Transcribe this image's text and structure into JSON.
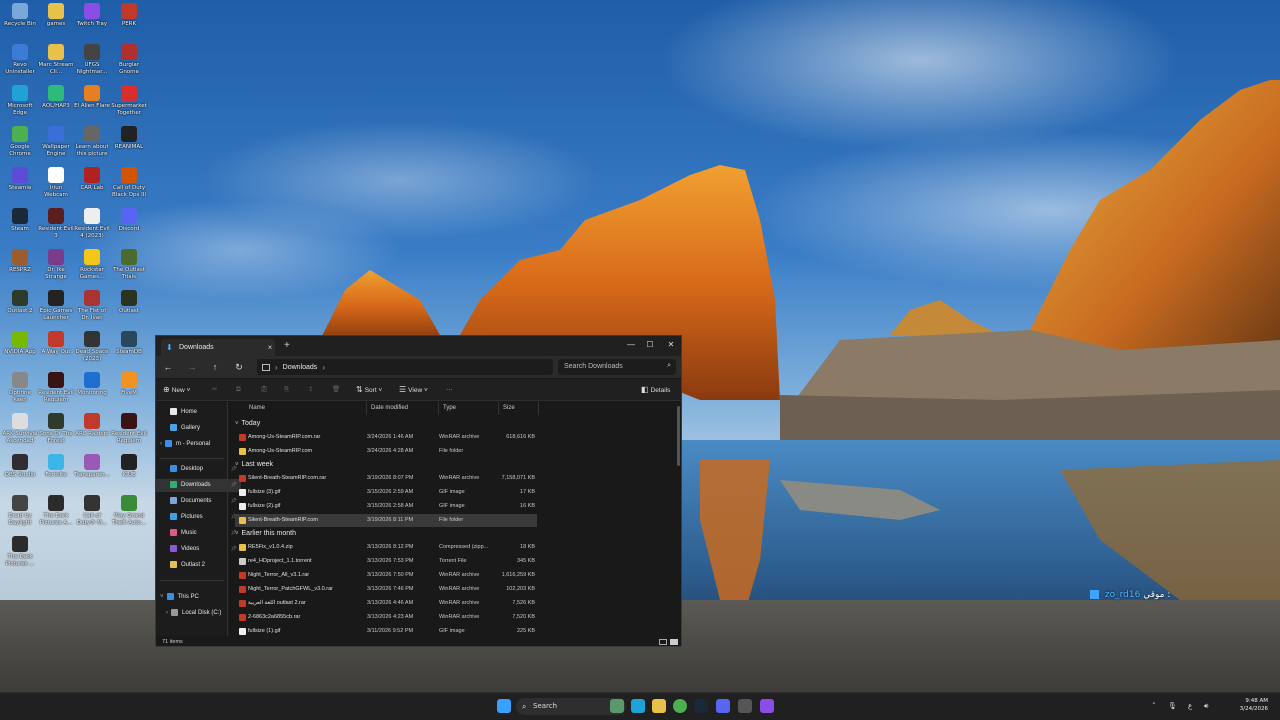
{
  "desktop": {
    "icons": [
      {
        "label": "Recycle Bin",
        "color": "#7aa7d9"
      },
      {
        "label": "games",
        "color": "#e8c14a"
      },
      {
        "label": "Twitch Tray",
        "color": "#8a4de6"
      },
      {
        "label": "PERK",
        "color": "#c0392b"
      },
      {
        "label": "Revo Uninstaller",
        "color": "#3d7bd6"
      },
      {
        "label": "Marc Stream Cli...",
        "color": "#e8c14a"
      },
      {
        "label": "UFGS Nightmar...",
        "color": "#444444"
      },
      {
        "label": "Burglar Gnome",
        "color": "#b03030"
      },
      {
        "label": "Microsoft Edge",
        "color": "#1fa3d6"
      },
      {
        "label": "AOL/HAP3",
        "color": "#2dba7a"
      },
      {
        "label": "El Alien Flare",
        "color": "#e67e22"
      },
      {
        "label": "Supermarket Together",
        "color": "#d92e2e"
      },
      {
        "label": "Google Chrome",
        "color": "#4caf50"
      },
      {
        "label": "Wallpaper Engine",
        "color": "#3a6fd9"
      },
      {
        "label": "Learn about this picture",
        "color": "#666666"
      },
      {
        "label": "REANIMAL",
        "color": "#222222"
      },
      {
        "label": "Steamie",
        "color": "#5b4bd6"
      },
      {
        "label": "Iriun Webcam",
        "color": "#ffffff"
      },
      {
        "label": "CAR Lab",
        "color": "#b02222"
      },
      {
        "label": "Call of Duty Black Ops III",
        "color": "#d35400"
      },
      {
        "label": "Steam",
        "color": "#1b2838"
      },
      {
        "label": "Resident Evil 3",
        "color": "#5a1e1e"
      },
      {
        "label": "Resident Evil 4 (2023)",
        "color": "#eeeeee"
      },
      {
        "label": "Discord",
        "color": "#5865f2"
      },
      {
        "label": "RESPRZ",
        "color": "#9b5d2e"
      },
      {
        "label": "Dr. Ike Strange",
        "color": "#7a3b8a"
      },
      {
        "label": "Rockstar Games...",
        "color": "#f5c518"
      },
      {
        "label": "The Outlast Trials",
        "color": "#4a6a2e"
      },
      {
        "label": "Outlast 2",
        "color": "#2f3b2a"
      },
      {
        "label": "Epic Games Launcher",
        "color": "#222222"
      },
      {
        "label": "The Fist of Dr. Ivan",
        "color": "#a33"
      },
      {
        "label": "Outlast",
        "color": "#2a3320"
      },
      {
        "label": "NVIDIA App",
        "color": "#76b900"
      },
      {
        "label": "A Way Out",
        "color": "#c0392b"
      },
      {
        "label": "Dead Space (2023)",
        "color": "#333333"
      },
      {
        "label": "SteamDB",
        "color": "#2a475e"
      },
      {
        "label": "Optifine Keen",
        "color": "#888888"
      },
      {
        "label": "Resident Evil Requiem",
        "color": "#3a1414"
      },
      {
        "label": "Monitoring",
        "color": "#1f6fd1"
      },
      {
        "label": "FiveM",
        "color": "#f29221"
      },
      {
        "label": "ARK Survival Ascended",
        "color": "#dddddd"
      },
      {
        "label": "Sons Of The Forest",
        "color": "#2e3b2a"
      },
      {
        "label": "ARC Raiders",
        "color": "#c0392b"
      },
      {
        "label": "Resident Evil Requiem",
        "color": "#3a1414"
      },
      {
        "label": "OBS Studio",
        "color": "#302e31"
      },
      {
        "label": "Fortnite",
        "color": "#3cb4e7"
      },
      {
        "label": "Transparen...",
        "color": "#9b59b6"
      },
      {
        "label": "ICUE",
        "color": "#222222"
      },
      {
        "label": "Dead by Daylight",
        "color": "#444444"
      },
      {
        "label": "The Dark Pictures A...",
        "color": "#2b2b2b"
      },
      {
        "label": "Call of Duty® M...",
        "color": "#333333"
      },
      {
        "label": "Play Grand Theft Auto...",
        "color": "#3a8a3a"
      },
      {
        "label": "The Dark Pictures ...",
        "color": "#2b2b2b"
      }
    ]
  },
  "explorer": {
    "tab_label": "Downloads",
    "breadcrumb": "Downloads",
    "search_placeholder": "Search Downloads",
    "commands": {
      "new": "New",
      "sort": "Sort",
      "view": "View",
      "more": "···",
      "details": "Details"
    },
    "nav": {
      "home": "Home",
      "gallery": "Gallery",
      "personal": "m - Personal",
      "desktop": "Desktop",
      "downloads": "Downloads",
      "documents": "Documents",
      "pictures": "Pictures",
      "music": "Music",
      "videos": "Videos",
      "outlast": "Outlast 2",
      "this_pc": "This PC",
      "local_disk": "Local Disk (C:)"
    },
    "columns": {
      "name": "Name",
      "date": "Date modified",
      "type": "Type",
      "size": "Size"
    },
    "groups": {
      "today": "Today",
      "last_week": "Last week",
      "earlier": "Earlier this month"
    },
    "files_today": [
      {
        "name": "Among-Us-SteamRIP.com.rar",
        "date": "3/24/2026 1:46 AM",
        "type": "WinRAR archive",
        "size": "618,616 KB",
        "icon": "rar"
      },
      {
        "name": "Among-Us-SteamRIP.com",
        "date": "3/24/2026 4:28 AM",
        "type": "File folder",
        "size": "",
        "icon": "folder"
      }
    ],
    "files_last_week": [
      {
        "name": "Silent-Breath-SteamRIP.com.rar",
        "date": "3/19/2026 8:07 PM",
        "type": "WinRAR archive",
        "size": "7,158,071 KB",
        "icon": "rar"
      },
      {
        "name": "fullsize (3).gif",
        "date": "3/15/2026 2:59 AM",
        "type": "GIF image",
        "size": "17 KB",
        "icon": "gif"
      },
      {
        "name": "fullsize (2).gif",
        "date": "3/15/2026 2:58 AM",
        "type": "GIF image",
        "size": "16 KB",
        "icon": "gif"
      },
      {
        "name": "Silent-Breath-SteamRIP.com",
        "date": "3/19/2026 8:11 PM",
        "type": "File folder",
        "size": "",
        "icon": "folder"
      }
    ],
    "files_earlier": [
      {
        "name": "RE5Fix_v1.0.4.zip",
        "date": "3/13/2026 8:12 PM",
        "type": "Compressed (zipp...",
        "size": "18 KB",
        "icon": "zip"
      },
      {
        "name": "re4_HDproject_1.1.torrent",
        "date": "3/13/2026 7:53 PM",
        "type": "Torrent File",
        "size": "345 KB",
        "icon": "torrent"
      },
      {
        "name": "Night_Terror_All_v3.1.rar",
        "date": "3/13/2026 7:50 PM",
        "type": "WinRAR archive",
        "size": "1,616,259 KB",
        "icon": "rar"
      },
      {
        "name": "Night_Terror_PatchGFWL_v3.0.rar",
        "date": "3/13/2026 7:46 PM",
        "type": "WinRAR archive",
        "size": "102,203 KB",
        "icon": "rar"
      },
      {
        "name": "اللغة العربية outlast 2.rar",
        "date": "3/13/2026 4:46 AM",
        "type": "WinRAR archive",
        "size": "7,526 KB",
        "icon": "rar"
      },
      {
        "name": "2-6863c2a6855cb.rar",
        "date": "3/13/2026 4:23 AM",
        "type": "WinRAR archive",
        "size": "7,520 KB",
        "icon": "rar"
      },
      {
        "name": "fullsize (1).gif",
        "date": "3/11/2026 9:52 PM",
        "type": "GIF image",
        "size": "225 KB",
        "icon": "gif"
      }
    ],
    "status": "71 items"
  },
  "chat": {
    "user": "zo_rd16",
    "text": "موقي :"
  },
  "taskbar": {
    "search_label": "Search",
    "clock_time": "9:48 AM",
    "clock_date": "3/24/2026"
  },
  "colors": {
    "rar": "#c0392b",
    "folder": "#e8c14a",
    "gif": "#eeeeee",
    "zip": "#e8c14a",
    "torrent": "#cccccc"
  }
}
